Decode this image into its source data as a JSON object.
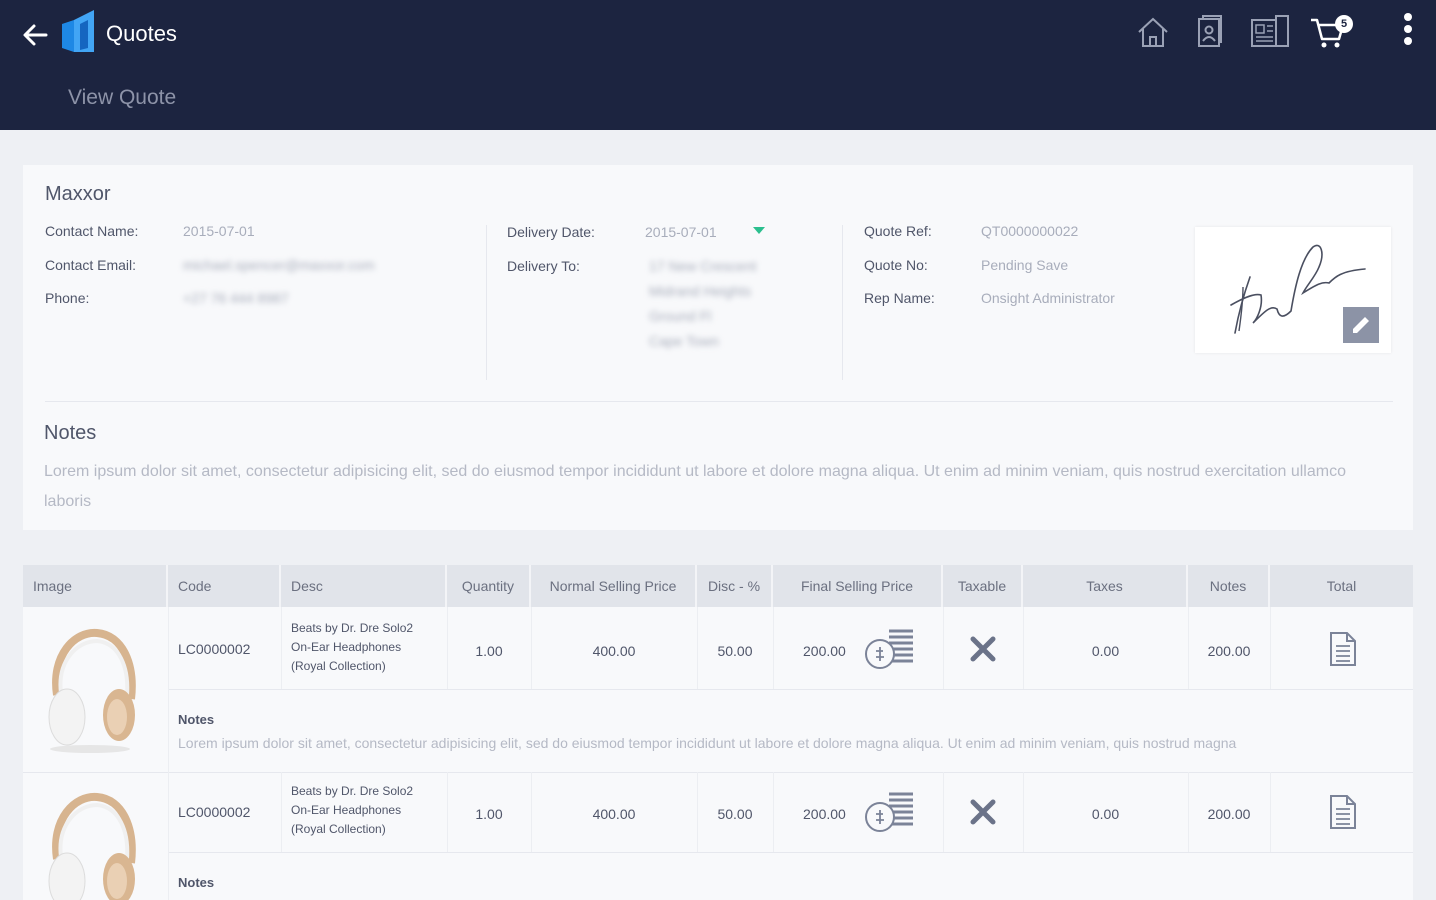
{
  "appbar": {
    "title": "Quotes",
    "subtitle": "View Quote",
    "cart_count": "5",
    "icons": [
      "back-arrow-icon",
      "app-logo-icon",
      "home-icon",
      "contacts-icon",
      "catalog-icon",
      "cart-icon",
      "more-vert-icon"
    ]
  },
  "quote": {
    "customer": "Maxxor",
    "labels": {
      "contact_name": "Contact Name:",
      "contact_email": "Contact Email:",
      "phone": "Phone:",
      "delivery_date": "Delivery Date:",
      "delivery_to": "Delivery To:",
      "quote_ref": "Quote Ref:",
      "quote_no": "Quote No:",
      "rep_name": "Rep Name:"
    },
    "contact_name": "2015-07-01",
    "contact_email": "michael.spencer@maxxor.com",
    "phone": "+27 76 444 8987",
    "delivery_date": "2015-07-01",
    "delivery_to": [
      "17 New Crescent",
      "Midrand Heights",
      "Ground Fl",
      "Cape Town"
    ],
    "quote_ref": "QT0000000022",
    "quote_no": "Pending Save",
    "rep_name": "Onsight Administrator"
  },
  "notes": {
    "heading": "Notes",
    "text": "Lorem ipsum dolor sit amet, consectetur adipisicing elit, sed do eiusmod tempor incididunt ut labore et dolore magna aliqua. Ut enim ad minim veniam, quis nostrud exercitation ullamco laboris"
  },
  "table": {
    "columns": [
      "Image",
      "Code",
      "Desc",
      "Quantity",
      "Normal Selling Price",
      "Disc - %",
      "Final Selling Price",
      "Taxable",
      "Taxes",
      "Notes",
      "Total"
    ],
    "rows": [
      {
        "code": "LC0000002",
        "desc": [
          "Beats by Dr. Dre Solo2",
          "On-Ear Headphones",
          "(Royal Collection)"
        ],
        "quantity": "1.00",
        "normal_price": "400.00",
        "disc": "50.00",
        "final_price": "200.00",
        "taxes": "0.00",
        "total": "200.00",
        "notes_label": "Notes",
        "notes_text": "Lorem ipsum dolor sit amet, consectetur adipisicing elit, sed do eiusmod tempor incididunt ut labore et dolore magna aliqua. Ut enim ad minim veniam, quis nostrud magna"
      },
      {
        "code": "LC0000002",
        "desc": [
          "Beats by Dr. Dre Solo2",
          "On-Ear Headphones",
          "(Royal Collection)"
        ],
        "quantity": "1.00",
        "normal_price": "400.00",
        "disc": "50.00",
        "final_price": "200.00",
        "taxes": "0.00",
        "total": "200.00",
        "notes_label": "Notes",
        "notes_text": ""
      }
    ]
  },
  "colors": {
    "appbar": "#1c2440",
    "accent": "#2bbf8e",
    "icon": "#7b8398"
  }
}
